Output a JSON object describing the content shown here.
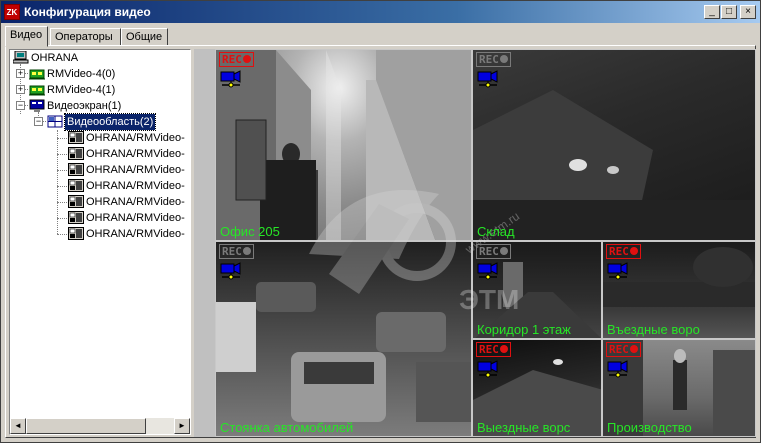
{
  "window": {
    "title": "Конфигурация видео",
    "app_icon_text": "ZK",
    "minimize": "_",
    "maximize": "□",
    "close": "×"
  },
  "tabs": [
    {
      "label": "Видео",
      "active": true
    },
    {
      "label": "Операторы",
      "active": false
    },
    {
      "label": "Общие",
      "active": false
    }
  ],
  "tree": {
    "root": "OHRANA",
    "nodes": [
      {
        "label": "RMVideo-4(0)",
        "icon": "video-card-icon",
        "expander": "+"
      },
      {
        "label": "RMVideo-4(1)",
        "icon": "video-card-icon",
        "expander": "+"
      },
      {
        "label": "Видеоэкран(1)",
        "icon": "monitor-icon",
        "expander": "−"
      },
      {
        "label": "Видеообласть(2)",
        "icon": "grid-icon",
        "expander": "−",
        "selected": true
      }
    ],
    "cameras": [
      "OHRANA/RMVideo-",
      "OHRANA/RMVideo-",
      "OHRANA/RMVideo-",
      "OHRANA/RMVideo-",
      "OHRANA/RMVideo-",
      "OHRANA/RMVideo-",
      "OHRANA/RMVideo-"
    ],
    "scroll_left": "◄",
    "scroll_right": "►"
  },
  "video": {
    "rec_label": "REC",
    "rec_active_color": "#e01010",
    "rec_idle_color": "#7a7a7a",
    "label_color": "#26e626",
    "tiles": [
      {
        "name": "Офис 205",
        "recording": true
      },
      {
        "name": "Склад",
        "recording": false
      },
      {
        "name": "Стоянка автомобилей",
        "recording": false
      },
      {
        "name": "Коридор 1 этаж",
        "recording": false
      },
      {
        "name": "Въездные воро",
        "recording": true
      },
      {
        "name": "Выездные ворс",
        "recording": true
      },
      {
        "name": "Производство",
        "recording": true
      }
    ],
    "watermark_text": "ЭТМ",
    "watermark_url": "www.etm.ru"
  }
}
